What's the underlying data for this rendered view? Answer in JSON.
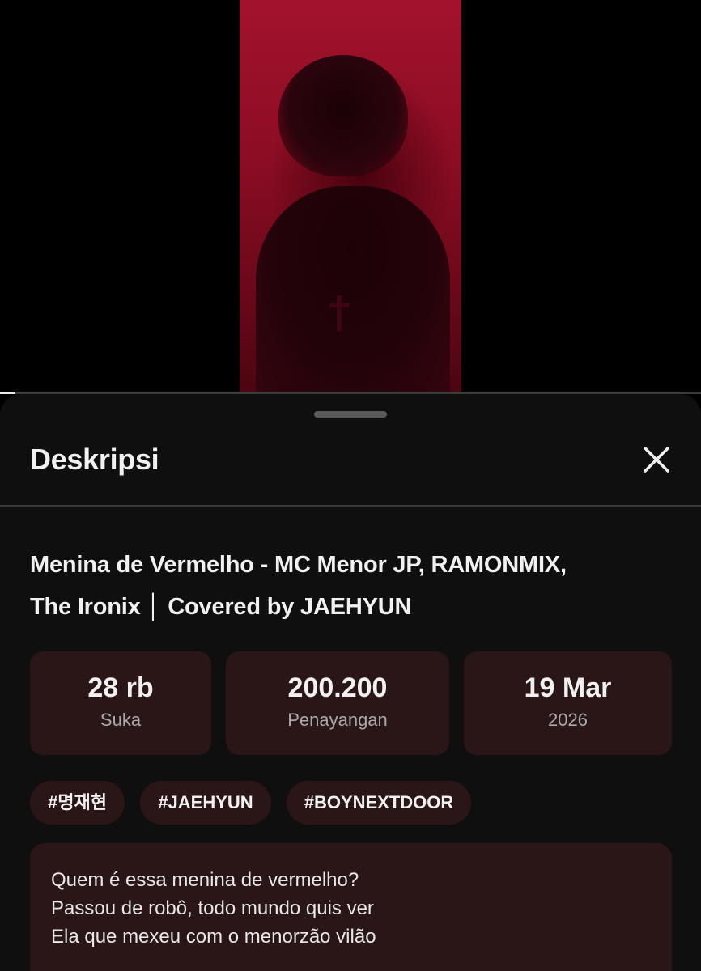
{
  "player": {
    "progress_fraction": 0.022
  },
  "sheet": {
    "title": "Deskripsi",
    "close_icon": "close-icon"
  },
  "video": {
    "title_line1": "Menina de Vermelho - MC Menor JP, RAMONMIX,",
    "title_line2": "The Ironix │ Covered by JAEHYUN"
  },
  "stats": {
    "likes": {
      "value": "28 rb",
      "label": "Suka"
    },
    "views": {
      "value": "200.200",
      "label": "Penayangan"
    },
    "date": {
      "value": "19 Mar",
      "label": "2026"
    }
  },
  "hashtags": [
    "#명재현",
    "#JAEHYUN",
    "#BOYNEXTDOOR"
  ],
  "description_lines": [
    "Quem é essa menina de vermelho?",
    "Passou de robô, todo mundo quis ver",
    "Ela que mexeu com o menorzão vilão"
  ],
  "colors": {
    "sheet_bg": "#0f0f0f",
    "card_bg": "#2a1616",
    "video_accent": "#a3122c"
  }
}
